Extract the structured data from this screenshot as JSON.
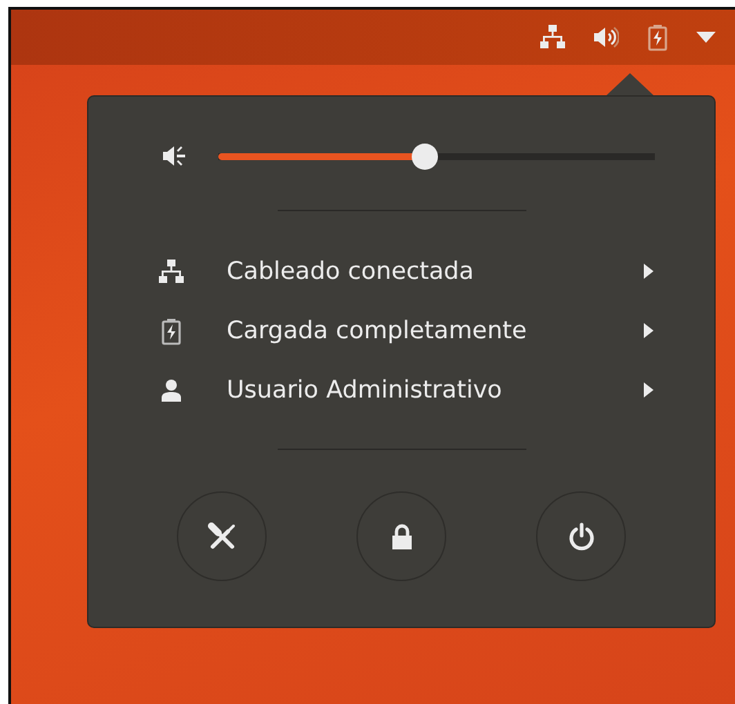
{
  "top_bar": {
    "indicators": [
      {
        "kind": "network"
      },
      {
        "kind": "volume"
      },
      {
        "kind": "battery"
      },
      {
        "kind": "menu-arrow"
      }
    ]
  },
  "volume": {
    "level": 0.47
  },
  "menu_items": [
    {
      "kind": "network",
      "label": "Cableado conectada"
    },
    {
      "kind": "battery",
      "label": "Cargada completamente"
    },
    {
      "kind": "user",
      "label": "Usuario Administrativo"
    }
  ],
  "actions": [
    {
      "kind": "settings"
    },
    {
      "kind": "lock"
    },
    {
      "kind": "power"
    }
  ]
}
